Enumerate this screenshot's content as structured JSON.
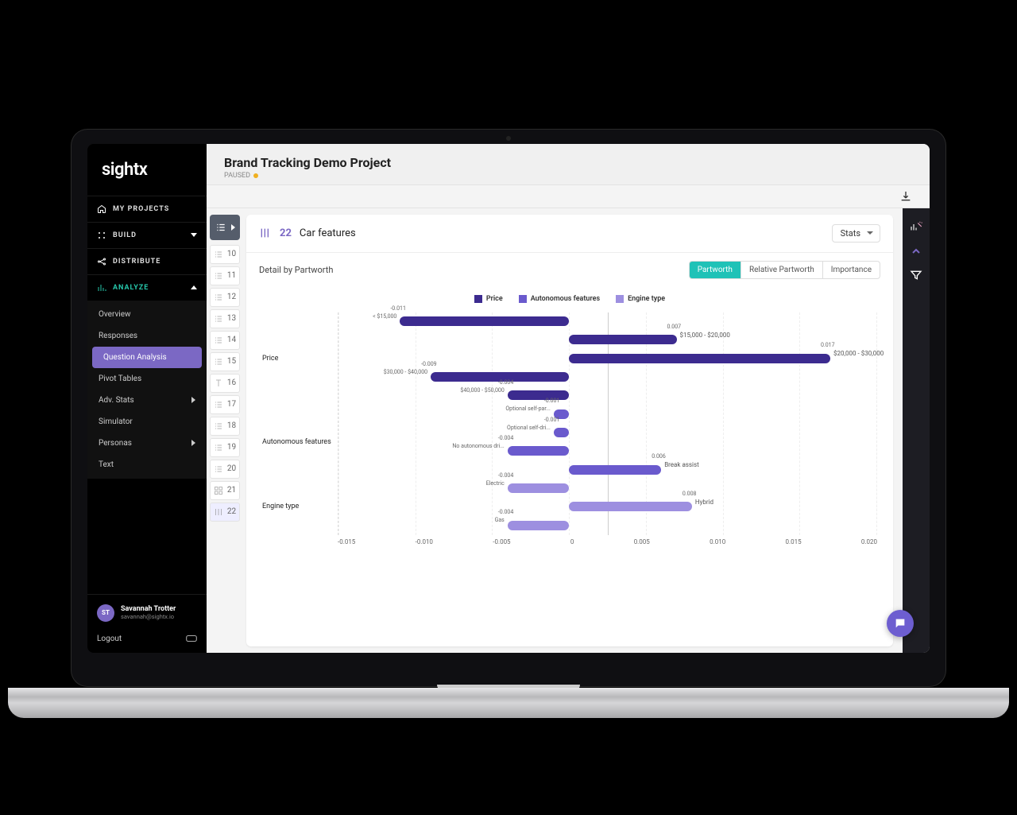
{
  "brand": "sightx",
  "nav": {
    "my_projects": "MY PROJECTS",
    "build": "BUILD",
    "distribute": "DISTRIBUTE",
    "analyze": "ANALYZE",
    "analyze_items": [
      {
        "label": "Overview"
      },
      {
        "label": "Responses"
      },
      {
        "label": "Question Analysis",
        "active": true
      },
      {
        "label": "Pivot Tables"
      },
      {
        "label": "Adv. Stats",
        "chevron": true
      },
      {
        "label": "Simulator"
      },
      {
        "label": "Personas",
        "chevron": true
      },
      {
        "label": "Text"
      }
    ]
  },
  "user": {
    "initials": "ST",
    "name": "Savannah Trotter",
    "email": "savannah@sightx.io",
    "logout": "Logout"
  },
  "project": {
    "title": "Brand Tracking Demo Project",
    "status": "PAUSED"
  },
  "qrail": {
    "items": [
      {
        "n": "10",
        "icon": "list"
      },
      {
        "n": "11",
        "icon": "list"
      },
      {
        "n": "12",
        "icon": "list"
      },
      {
        "n": "13",
        "icon": "list"
      },
      {
        "n": "14",
        "icon": "list"
      },
      {
        "n": "15",
        "icon": "list"
      },
      {
        "n": "16",
        "icon": "text"
      },
      {
        "n": "17",
        "icon": "list"
      },
      {
        "n": "18",
        "icon": "list"
      },
      {
        "n": "19",
        "icon": "list"
      },
      {
        "n": "20",
        "icon": "list"
      },
      {
        "n": "21",
        "icon": "grid"
      },
      {
        "n": "22",
        "icon": "conjoint",
        "active": true
      }
    ]
  },
  "question": {
    "number": "22",
    "title": "Car features",
    "dropdown": "Stats",
    "subtitle": "Detail by Partworth",
    "tabs": [
      "Partworth",
      "Relative Partworth",
      "Importance"
    ],
    "active_tab": 0
  },
  "legend": [
    {
      "label": "Price",
      "color": "#3c2b8f"
    },
    {
      "label": "Autonomous features",
      "color": "#6a5acd"
    },
    {
      "label": "Engine type",
      "color": "#9d8fe0"
    }
  ],
  "groups": [
    "Price",
    "Autonomous features",
    "Engine type"
  ],
  "xticks": [
    "-0.015",
    "-0.010",
    "-0.005",
    "0",
    "0.005",
    "0.010",
    "0.015",
    "0.020"
  ],
  "chart_data": {
    "type": "bar",
    "orientation": "horizontal",
    "title": "Detail by Partworth",
    "xlabel": "",
    "ylabel": "",
    "xlim": [
      -0.015,
      0.02
    ],
    "series": [
      {
        "name": "Price",
        "color": "#3c2b8f",
        "bars": [
          {
            "label": "< $15,000",
            "value": -0.011
          },
          {
            "label": "$15,000 - $20,000",
            "value": 0.007
          },
          {
            "label": "$20,000 - $30,000",
            "value": 0.017
          },
          {
            "label": "$30,000 - $40,000",
            "value": -0.009
          },
          {
            "label": "$40,000 - $50,000",
            "value": -0.004
          }
        ]
      },
      {
        "name": "Autonomous features",
        "color": "#6a5acd",
        "bars": [
          {
            "label": "Optional self-par...",
            "value": -0.001
          },
          {
            "label": "Optional self-dri...",
            "value": -0.001
          },
          {
            "label": "No autonomous dri...",
            "value": -0.004
          },
          {
            "label": "Break assist",
            "value": 0.006
          }
        ]
      },
      {
        "name": "Engine type",
        "color": "#9d8fe0",
        "bars": [
          {
            "label": "Electric",
            "value": -0.004
          },
          {
            "label": "Hybrid",
            "value": 0.008
          },
          {
            "label": "Gas",
            "value": -0.004
          }
        ]
      }
    ]
  }
}
